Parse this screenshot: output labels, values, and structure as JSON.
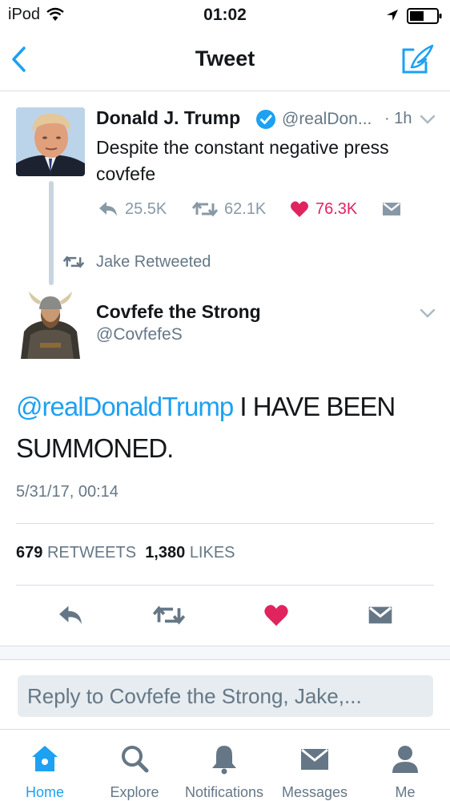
{
  "status_bar": {
    "carrier": "iPod",
    "time": "01:02"
  },
  "nav": {
    "title": "Tweet"
  },
  "parent_tweet": {
    "name": "Donald J. Trump",
    "handle": "@realDon...",
    "time": "· 1h",
    "text": "Despite the constant negative press covfefe",
    "replies": "25.5K",
    "retweets": "62.1K",
    "likes": "76.3K",
    "liked": true
  },
  "retweet_context": "Jake Retweeted",
  "main_tweet": {
    "name": "Covfefe the Strong",
    "handle": "@CovfefeS",
    "mention": "@realDonaldTrump",
    "text": " I HAVE BEEN SUMMONED.",
    "timestamp": "5/31/17, 00:14",
    "retweet_count": "679",
    "retweet_label": "RETWEETS",
    "like_count": "1,380",
    "like_label": "LIKES"
  },
  "reply_box": {
    "placeholder": "Reply to Covfefe the Strong, Jake,..."
  },
  "tab_bar": {
    "active": "Home",
    "tabs": [
      {
        "label": "Home",
        "icon": "home-icon"
      },
      {
        "label": "Explore",
        "icon": "search-icon"
      },
      {
        "label": "Notifications",
        "icon": "bell-icon"
      },
      {
        "label": "Messages",
        "icon": "envelope-icon"
      },
      {
        "label": "Me",
        "icon": "person-icon"
      }
    ]
  },
  "colors": {
    "accent": "#1da1f2",
    "like": "#e0245e",
    "muted": "#657786"
  }
}
